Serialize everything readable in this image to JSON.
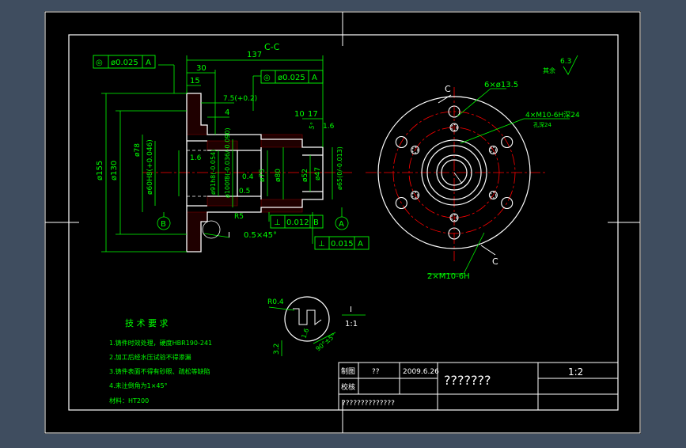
{
  "colors": {
    "background_outer": "#3f4d5f",
    "paper": "#000000",
    "frame": "#ffffff",
    "geometry": "#ffffff",
    "dimension": "#00ff00",
    "centerline": "#ff0000",
    "hatch": "#ff0000"
  },
  "section_label": "C-C",
  "dimensions": {
    "d137": "137",
    "d30": "30",
    "d15": "15",
    "d7_5": "7.5(+0.2)",
    "d4": "4",
    "d10": "10",
    "d17": "17",
    "d16a": "1.6",
    "d16b": "1.6",
    "d16c": "1.6",
    "d155": "ø155",
    "d130": "ø130",
    "d78": "ø78",
    "d60": "ø60H8(+0.046)",
    "d91": "ø91h8(-0.054)",
    "d100": "ø100f8(-0.036/-0.090)",
    "d75": "ø75",
    "d80": "ø80",
    "d52": "ø52",
    "d47": "ø47",
    "d65": "ø65(0/-0.013)",
    "d04": "0.4",
    "d05": "0.5",
    "d05x45": "0.5×45°",
    "r5": "R5",
    "angle5": "5°",
    "d6x13": "6×ø13.5",
    "d4xm10": "4×M10-6H深24",
    "d4xm10_sub": "孔深24",
    "d2xm10": "2×M10-6H",
    "c_mark1": "C",
    "c_mark2": "C",
    "ref_b": "B",
    "ref_a": "A",
    "callout_1": "I",
    "r04": "R0.4",
    "d32": "3.2",
    "d1_6x": "1.6",
    "angle_detail": "90°±5°",
    "detail_label": "I",
    "detail_scale": "1:1",
    "roughness_other": "其余",
    "roughness_value": "6.3"
  },
  "tolerances": {
    "concentricity_top": {
      "symbol": "◎",
      "value": "ø0.025",
      "datum": "A"
    },
    "concentricity_right": {
      "symbol": "◎",
      "value": "ø0.025",
      "datum": "A"
    },
    "perp_b": {
      "symbol": "⊥",
      "value": "0.012",
      "datum": "B"
    },
    "perp_a": {
      "symbol": "⊥",
      "value": "0.015",
      "datum": "A"
    }
  },
  "tech_req": {
    "title": "技 术 要 求",
    "items": [
      "1.铸件时效处理，硬度HBR190-241",
      "2.加工后经水压试验不得渗漏",
      "3.铸件表面不得有砂眼、疏松等缺陷",
      "4.未注倒角为1×45°"
    ],
    "material": "材料：HT200"
  },
  "title_block": {
    "drawn_label": "制图",
    "drawn_name": "??",
    "date": "2009.6.26",
    "checked_label": "校核",
    "part_name": "???????",
    "scale": "1:2",
    "org": "??????????????"
  }
}
